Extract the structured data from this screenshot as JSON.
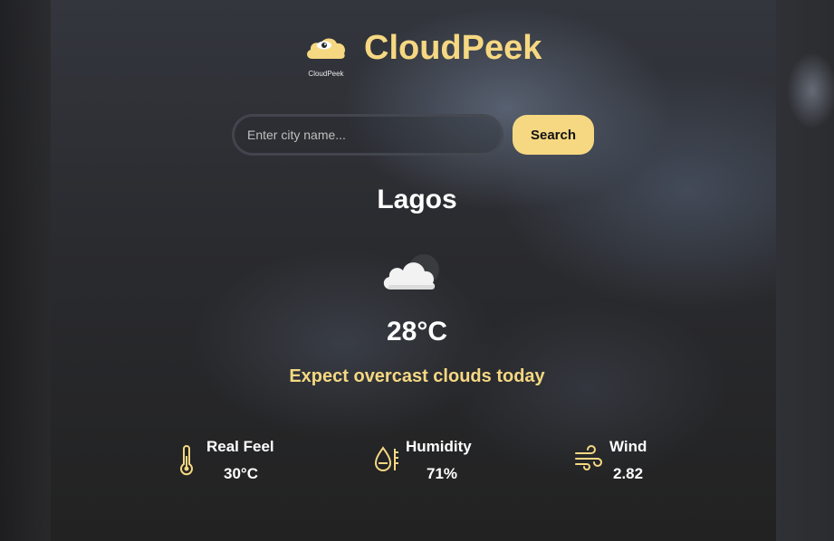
{
  "app": {
    "title": "CloudPeek",
    "logo_caption": "CloudPeek"
  },
  "search": {
    "placeholder": "Enter city name...",
    "value": "",
    "button_label": "Search"
  },
  "weather": {
    "city": "Lagos",
    "icon": "cloud-icon",
    "temperature": "28°C",
    "description": "Expect overcast clouds today"
  },
  "stats": {
    "real_feel": {
      "label": "Real Feel",
      "value": "30°C",
      "icon": "thermometer-icon"
    },
    "humidity": {
      "label": "Humidity",
      "value": "71%",
      "icon": "humidity-icon"
    },
    "wind": {
      "label": "Wind",
      "value": "2.82",
      "icon": "wind-icon"
    }
  },
  "colors": {
    "accent": "#f6d882",
    "text": "#ffffff",
    "background": "#2a2b2f"
  }
}
